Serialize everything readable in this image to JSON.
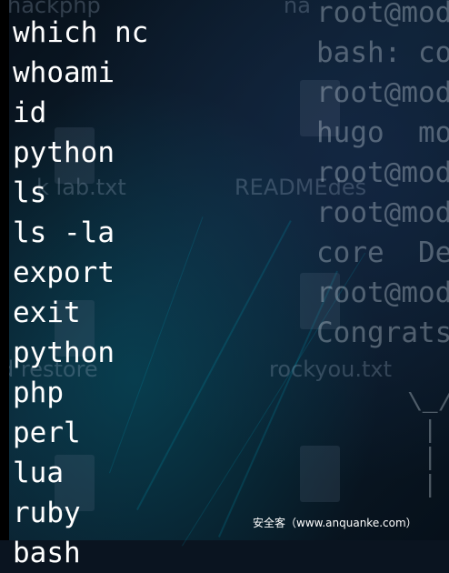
{
  "terminal_left": {
    "lines": [
      "which nc",
      "whoami",
      "id",
      "python",
      "ls",
      "ls -la",
      "export",
      "exit",
      "python",
      "php",
      "perl",
      "lua",
      "ruby",
      "bash"
    ]
  },
  "terminal_right": {
    "lines": [
      "root@mod",
      "bash: co",
      "root@mod",
      "hugo  mo",
      "root@mod",
      "root@mod",
      "core  De",
      "root@mod",
      "Congrats"
    ]
  },
  "desktop": {
    "labels": [
      "hackphp",
      "na",
      "k lab.txt",
      "READMEdes",
      "d restore",
      "rockyou.txt"
    ]
  },
  "watermark": "安全客（www.anquanke.com）"
}
